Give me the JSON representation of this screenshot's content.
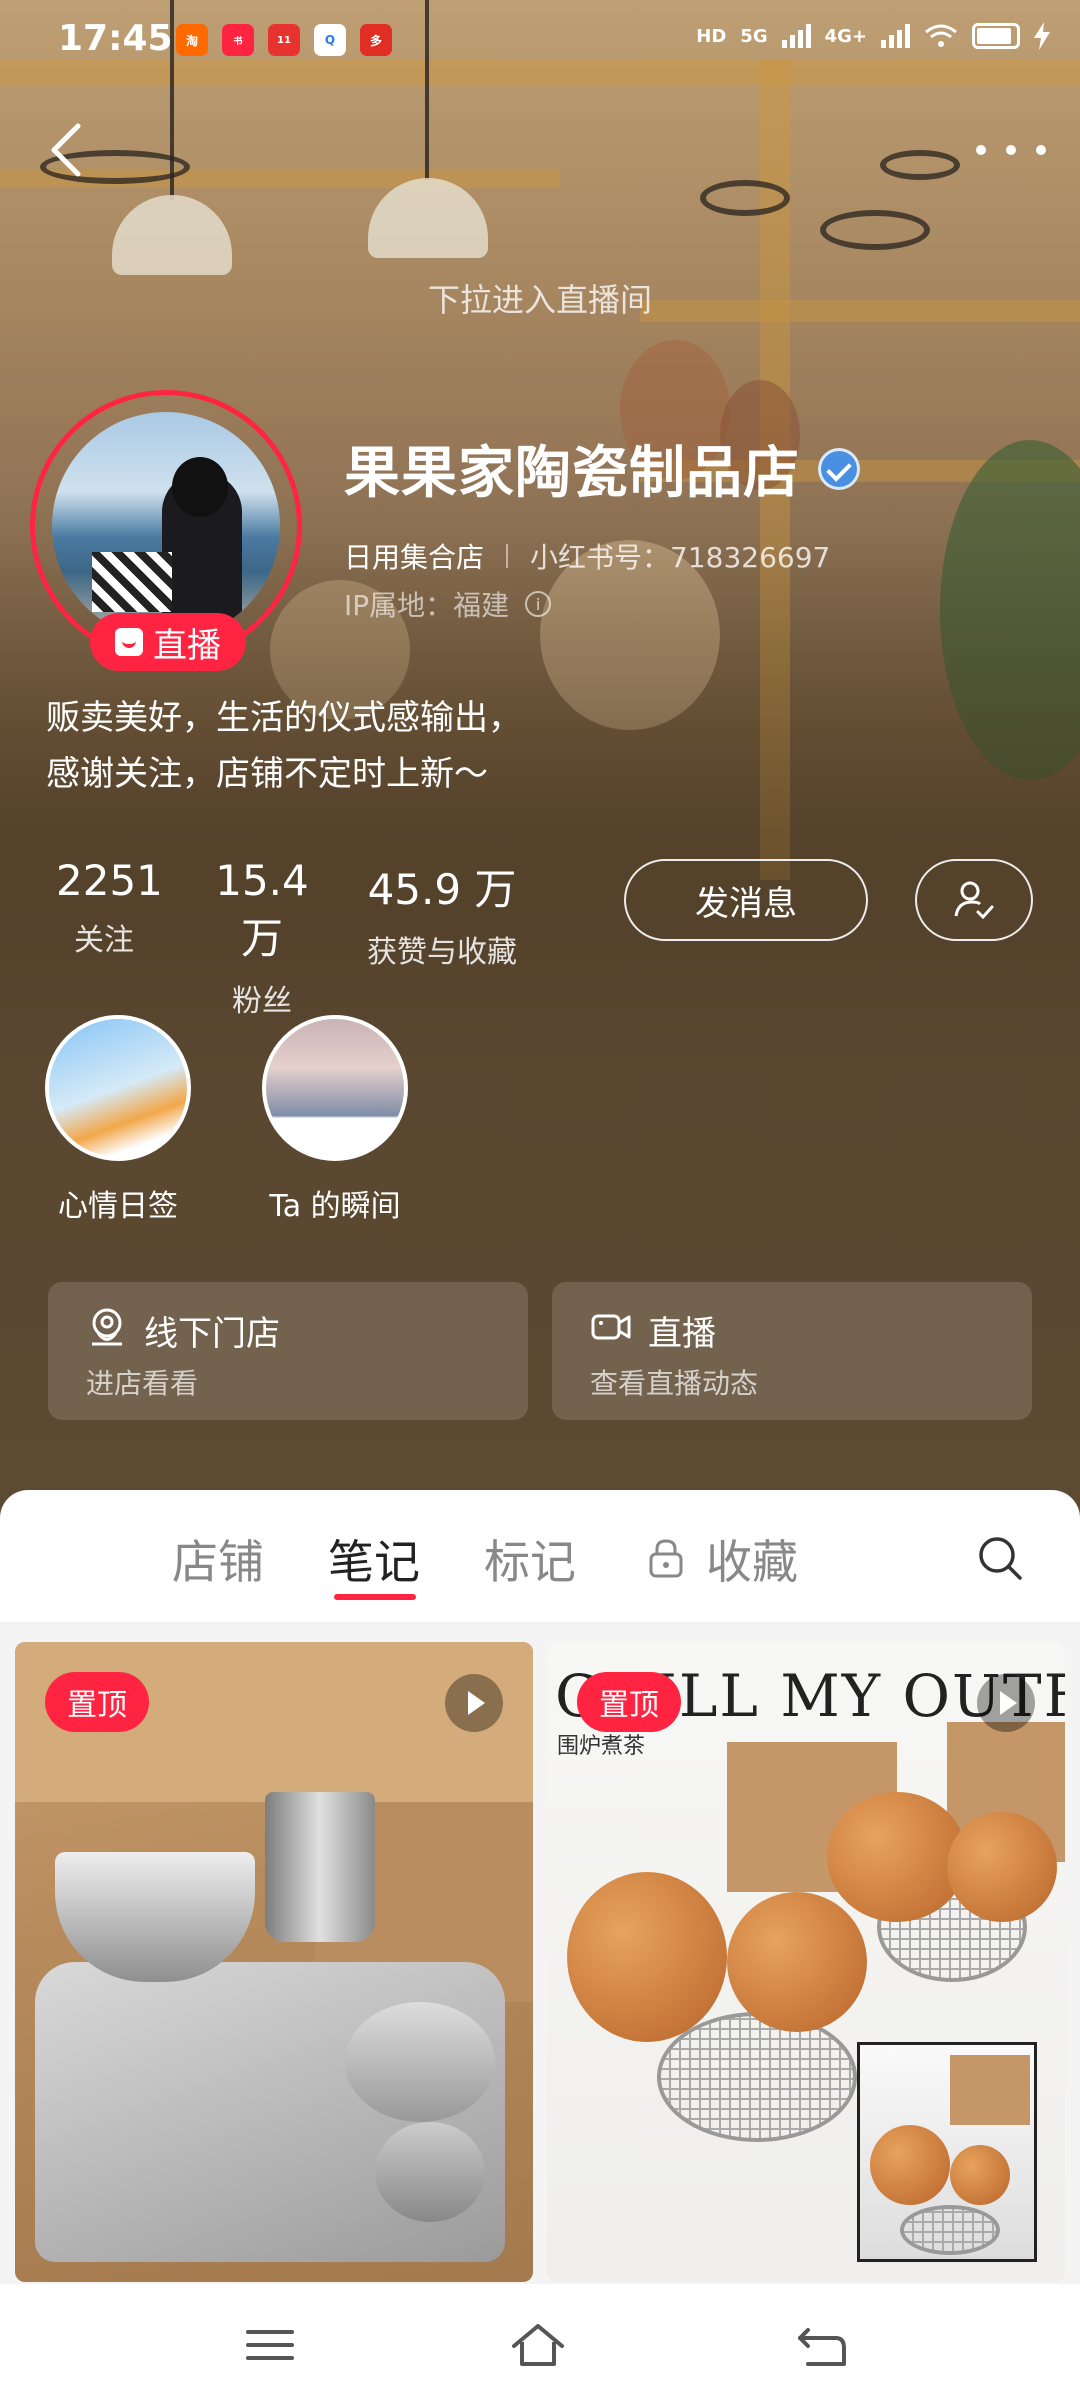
{
  "status_bar": {
    "time": "17:45",
    "apps": [
      "淘",
      "小红书",
      "双11",
      "Q",
      "多"
    ],
    "network": [
      "HD",
      "5G",
      "4G+"
    ],
    "colors": {
      "accent": "#ff2442"
    }
  },
  "header": {
    "pull_hint": "下拉进入直播间"
  },
  "profile": {
    "name": "果果家陶瓷制品店",
    "verified": true,
    "category": "日用集合店",
    "xhs_id": "小红书号：718326697",
    "ip": "IP属地：福建",
    "live_badge": "直播",
    "bio_line1": "贩卖美好，生活的仪式感输出，",
    "bio_line2": "感谢关注，店铺不定时上新～"
  },
  "stats": [
    {
      "value": "2251",
      "label": "关注"
    },
    {
      "value": "15.4 万",
      "label": "粉丝"
    },
    {
      "value": "45.9 万",
      "label": "获赞与收藏"
    }
  ],
  "actions": {
    "message": "发消息"
  },
  "highlights": [
    {
      "label": "心情日签"
    },
    {
      "label": "Ta 的瞬间"
    }
  ],
  "cards": [
    {
      "title": "线下门店",
      "sub": "进店看看",
      "icon": "location-icon"
    },
    {
      "title": "直播",
      "sub": "查看直播动态",
      "icon": "video-icon"
    }
  ],
  "tabs": [
    {
      "label": "店铺"
    },
    {
      "label": "笔记",
      "active": true
    },
    {
      "label": "标记"
    },
    {
      "label": "收藏",
      "locked": true
    }
  ],
  "notes": [
    {
      "pin": "置顶",
      "has_video": true
    },
    {
      "pin": "置顶",
      "has_video": true,
      "headline": "CHILL MY OUTFIT",
      "subline": "围炉煮茶"
    }
  ]
}
